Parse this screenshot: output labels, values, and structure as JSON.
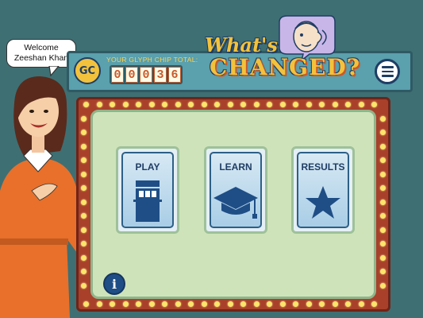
{
  "welcome": {
    "line1": "Welcome",
    "line2": "Zeeshan Khan"
  },
  "header": {
    "title_line1": "What's",
    "title_line2": "CHANGED?",
    "chip_label": "YOUR GLYPH CHIP TOTAL:",
    "chip_badge": "GC",
    "chip_digits": [
      "0",
      "0",
      "0",
      "3",
      "6"
    ]
  },
  "buttons": {
    "play": "PLAY",
    "learn": "LEARN",
    "results": "RESULTS"
  },
  "icons": {
    "menu": "hamburger-menu-icon",
    "info": "info-icon",
    "play": "slot-machine-icon",
    "learn": "graduation-cap-icon",
    "results": "star-icon"
  },
  "info_glyph": "i",
  "colors": {
    "background": "#3e6f73",
    "header_bar": "#5aa0ad",
    "title_yellow": "#f3c23c",
    "frame_red": "#a8402a",
    "panel_green": "#cfe3ba",
    "navy": "#1f3d64",
    "bulb": "#ffe46a"
  }
}
